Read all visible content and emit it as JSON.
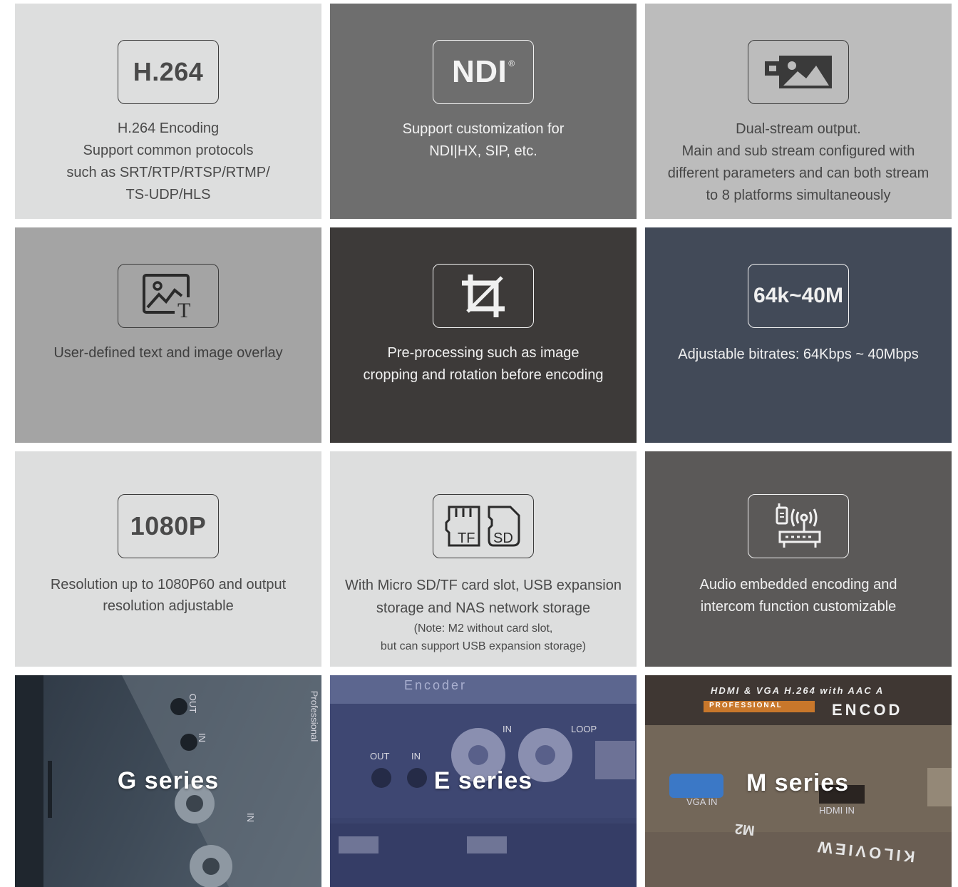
{
  "features": [
    {
      "badge_text": "H.264",
      "lines": [
        "H.264 Encoding",
        "Support common protocols",
        "such as SRT/RTP/RTSP/RTMP/",
        "TS-UDP/HLS"
      ]
    },
    {
      "badge_text": "NDI",
      "badge_mark": "®",
      "lines": [
        "Support customization for",
        "NDI|HX, SIP, etc."
      ]
    },
    {
      "icon": "image-icon",
      "lines": [
        "Dual-stream output.",
        "Main and sub stream configured with",
        "different parameters and can both stream",
        "to 8 platforms simultaneously"
      ]
    },
    {
      "icon": "image-text-overlay-icon",
      "lines": [
        "User-defined text and image overlay"
      ]
    },
    {
      "icon": "crop-icon",
      "lines": [
        "Pre-processing such as image",
        "cropping and rotation before encoding"
      ]
    },
    {
      "badge_text": "64k~40M",
      "lines": [
        "Adjustable bitrates: 64Kbps ~ 40Mbps"
      ]
    },
    {
      "badge_text": "1080P",
      "lines": [
        "Resolution up to 1080P60 and output",
        "resolution adjustable"
      ]
    },
    {
      "icon": "tf-sd-card-icon",
      "card_labels": [
        "TF",
        "SD"
      ],
      "lines": [
        "With Micro SD/TF card slot, USB expansion",
        "storage and NAS network storage"
      ],
      "notes": [
        "(Note: M2 without card slot,",
        "but can support USB expansion storage)"
      ]
    },
    {
      "icon": "audio-intercom-router-icon",
      "lines": [
        "Audio embedded encoding and",
        "intercom function customizable"
      ]
    }
  ],
  "series": [
    {
      "title": "G series",
      "captions": [
        "OUT",
        "IN",
        "Professional",
        "IN"
      ]
    },
    {
      "title": "E series",
      "captions": [
        "Encoder",
        "IN",
        "LOOP",
        "OUT",
        "IN"
      ]
    },
    {
      "title": "M series",
      "captions": [
        "HDMI & VGA H.264 with AAC A",
        "PROFESSIONAL",
        "ENCOD",
        "VGA IN",
        "HDMI IN",
        "M2",
        "KILOVIEW"
      ]
    }
  ]
}
